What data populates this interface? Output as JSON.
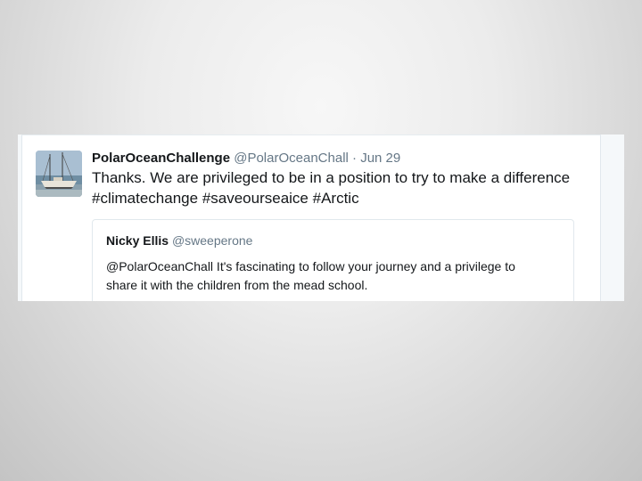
{
  "tweet": {
    "author_name": "PolarOceanChallenge",
    "author_handle": "@PolarOceanChall",
    "separator": "·",
    "date": "Jun 29",
    "text_line1": "Thanks. We are privileged to be in a position to try to make a difference",
    "hashtags": [
      "#climatechange",
      "#saveourseaice",
      "#Arctic"
    ],
    "avatar_icon": "sailboat-avatar"
  },
  "quoted_tweet": {
    "author_name": "Nicky Ellis",
    "author_handle": "@sweeperone",
    "text_line1": "@PolarOceanChall It's fascinating to follow your journey and a privilege to",
    "text_line2": "share it with the children from the mead school."
  },
  "colors": {
    "text": "#14171a",
    "secondary": "#657786",
    "border": "#e1e8ed"
  }
}
